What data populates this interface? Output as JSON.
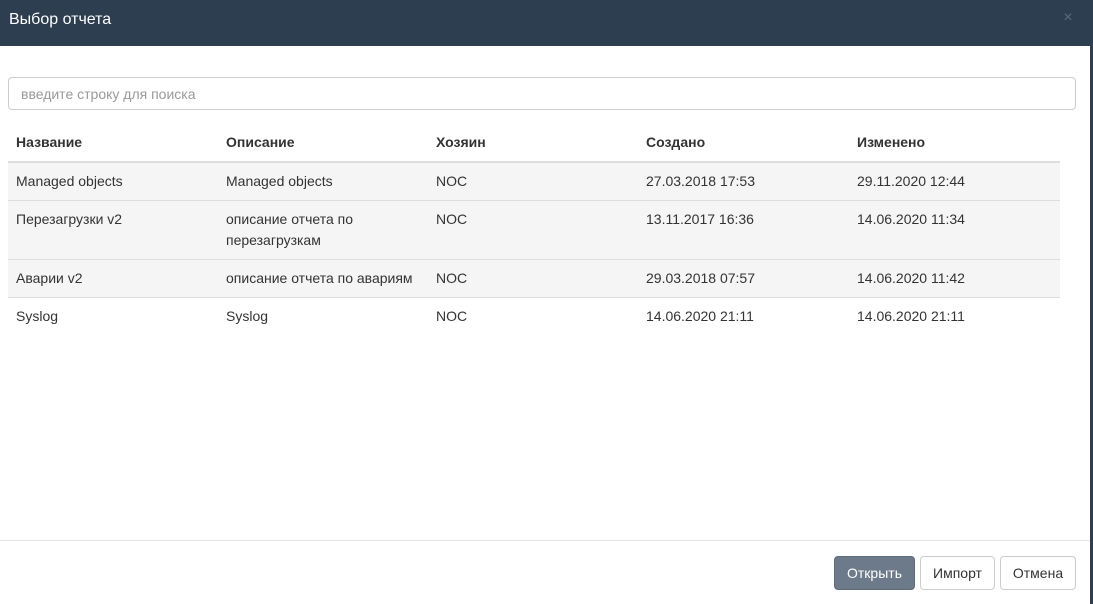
{
  "dialog": {
    "title": "Выбор отчета",
    "close_icon": "×"
  },
  "search": {
    "placeholder": "введите строку для поиска",
    "value": ""
  },
  "table": {
    "columns": [
      "Название",
      "Описание",
      "Хозяин",
      "Создано",
      "Изменено"
    ],
    "rows": [
      [
        "Managed objects",
        "Managed objects",
        "NOC",
        "27.03.2018 17:53",
        "29.11.2020 12:44"
      ],
      [
        "Перезагрузки v2",
        "описание отчета по перезагрузкам",
        "NOC",
        "13.11.2017 16:36",
        "14.06.2020 11:34"
      ],
      [
        "Аварии v2",
        "описание отчета по авариям",
        "NOC",
        "29.03.2018 07:57",
        "14.06.2020 11:42"
      ],
      [
        "Syslog",
        "Syslog",
        "NOC",
        "14.06.2020 21:11",
        "14.06.2020 21:11"
      ]
    ]
  },
  "footer": {
    "open_label": "Открыть",
    "import_label": "Импорт",
    "cancel_label": "Отмена"
  },
  "colors": {
    "header_bg": "#2d3e50",
    "primary_button": "#6c7a89",
    "stripe": "#f5f5f5"
  }
}
